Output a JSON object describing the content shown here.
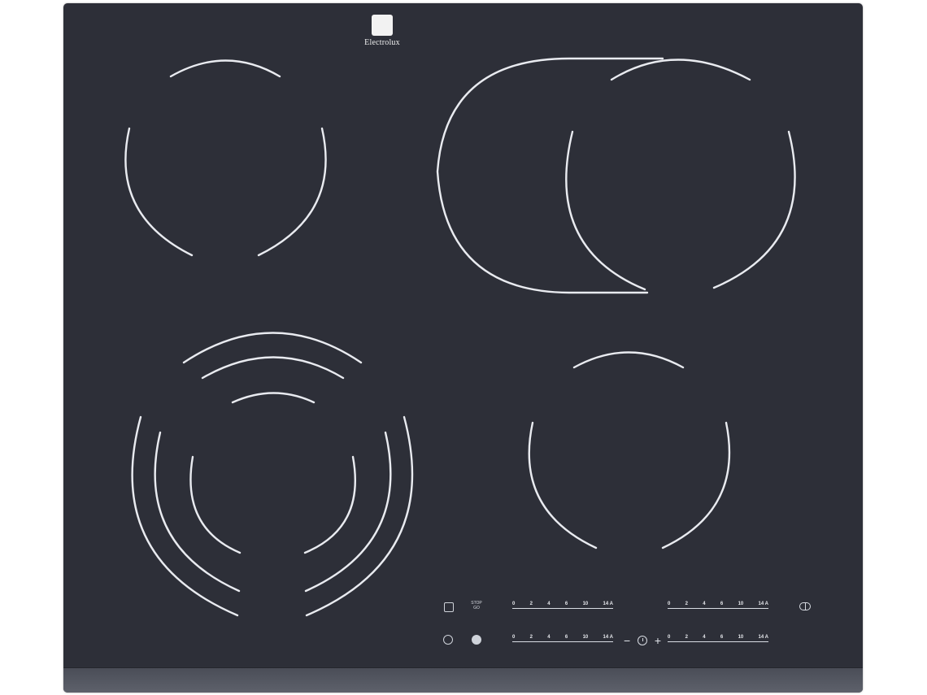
{
  "brand": {
    "name": "Electrolux"
  },
  "controls": {
    "top_left_icon": "lock-icon",
    "top_mid_label_1": "STOP",
    "top_mid_label_2": "GO",
    "bottom_left_icon": "power-icon",
    "bottom_mid_icon": "burner-icon",
    "right_icon": "dual-zone-icon",
    "timer_minus": "−",
    "timer_plus": "+",
    "sliders": [
      [
        "0",
        "2",
        "4",
        "6",
        "10",
        "14 A"
      ],
      [
        "0",
        "2",
        "4",
        "6",
        "10",
        "14 A"
      ],
      [
        "0",
        "2",
        "4",
        "6",
        "10",
        "14 A"
      ],
      [
        "0",
        "2",
        "4",
        "6",
        "10",
        "14 A"
      ]
    ]
  }
}
